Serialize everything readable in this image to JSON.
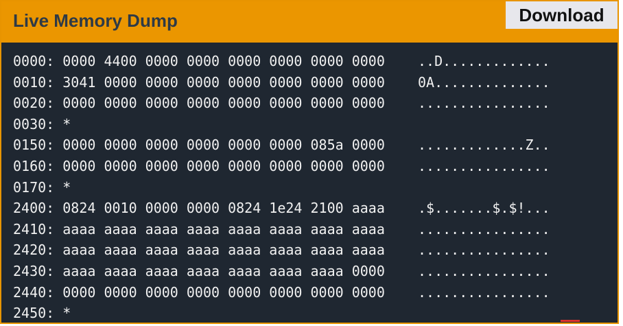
{
  "header": {
    "title": "Live Memory Dump",
    "download_label": "Download"
  },
  "dump": {
    "rows": [
      {
        "addr": "0000:",
        "hex": "0000 4400 0000 0000 0000 0000 0000 0000",
        "ascii": "..D............."
      },
      {
        "addr": "0010:",
        "hex": "3041 0000 0000 0000 0000 0000 0000 0000",
        "ascii": "0A.............."
      },
      {
        "addr": "0020:",
        "hex": "0000 0000 0000 0000 0000 0000 0000 0000",
        "ascii": "................"
      },
      {
        "addr": "0030:",
        "hex": "*",
        "ascii": ""
      },
      {
        "addr": "0150:",
        "hex": "0000 0000 0000 0000 0000 0000 085a 0000",
        "ascii": ".............Z.."
      },
      {
        "addr": "0160:",
        "hex": "0000 0000 0000 0000 0000 0000 0000 0000",
        "ascii": "................"
      },
      {
        "addr": "0170:",
        "hex": "*",
        "ascii": ""
      },
      {
        "addr": "2400:",
        "hex": "0824 0010 0000 0000 0824 1e24 2100 aaaa",
        "ascii": ".$.......$.$!..."
      },
      {
        "addr": "2410:",
        "hex": "aaaa aaaa aaaa aaaa aaaa aaaa aaaa aaaa",
        "ascii": "................"
      },
      {
        "addr": "2420:",
        "hex": "aaaa aaaa aaaa aaaa aaaa aaaa aaaa aaaa",
        "ascii": "................"
      },
      {
        "addr": "2430:",
        "hex": "aaaa aaaa aaaa aaaa aaaa aaaa aaaa 0000",
        "ascii": "................"
      },
      {
        "addr": "2440:",
        "hex": "0000 0000 0000 0000 0000 0000 0000 0000",
        "ascii": "................"
      },
      {
        "addr": "2450:",
        "hex": "*",
        "ascii": ""
      }
    ]
  },
  "colors": {
    "header_bg": "#eb9600",
    "panel_bg": "#1f2731",
    "text": "#f1f1f1",
    "title_text": "#2e3a46"
  }
}
